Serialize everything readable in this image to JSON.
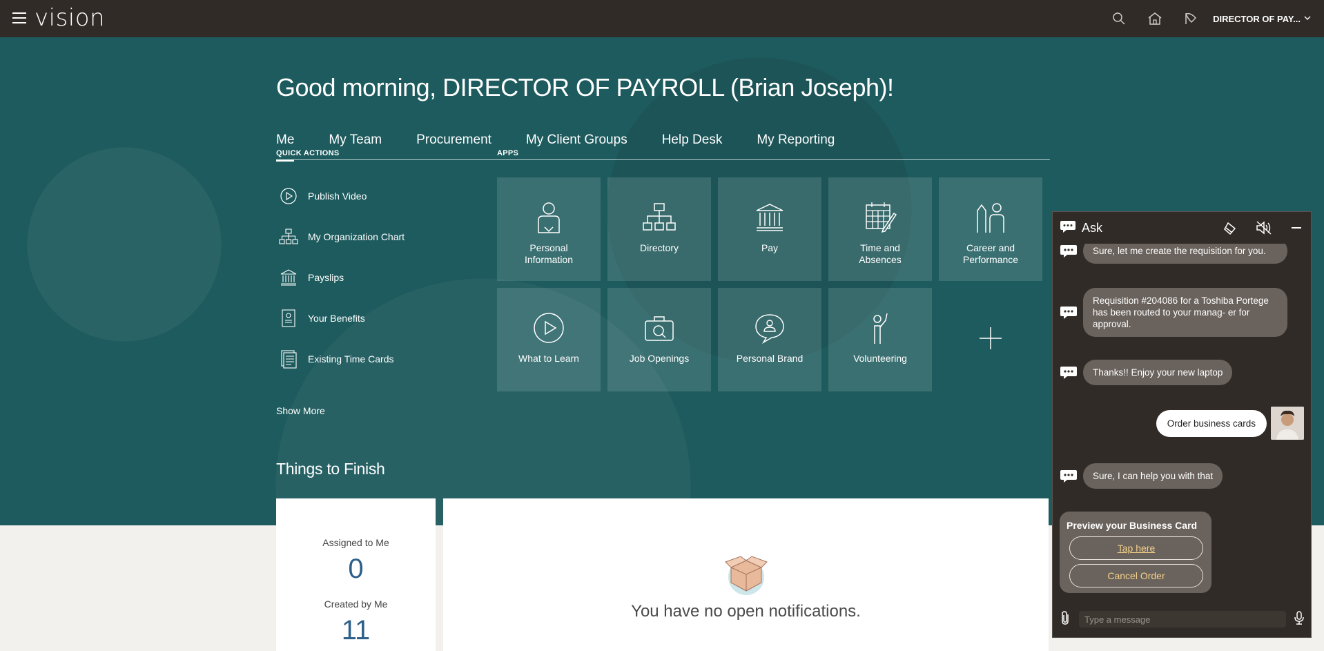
{
  "topbar": {
    "logo": "vision",
    "user_name": "DIRECTOR OF PAY...",
    "icons": [
      "search-icon",
      "home-icon",
      "notifications-icon",
      "chevron-down-icon"
    ]
  },
  "greeting": "Good morning, DIRECTOR OF PAYROLL (Brian Joseph)!",
  "tabs": [
    {
      "label": "Me",
      "active": true
    },
    {
      "label": "My Team"
    },
    {
      "label": "Procurement"
    },
    {
      "label": "My Client Groups"
    },
    {
      "label": "Help Desk"
    },
    {
      "label": "My Reporting"
    }
  ],
  "quick_actions": {
    "title": "QUICK ACTIONS",
    "items": [
      {
        "label": "Publish Video",
        "icon": "play-icon"
      },
      {
        "label": "My Organization Chart",
        "icon": "org-chart-icon"
      },
      {
        "label": "Payslips",
        "icon": "bank-icon"
      },
      {
        "label": "Your Benefits",
        "icon": "benefits-icon"
      },
      {
        "label": "Existing Time Cards",
        "icon": "timecard-icon"
      }
    ],
    "show_more": "Show More"
  },
  "apps": {
    "title": "APPS",
    "tiles": [
      {
        "label": "Personal Information",
        "icon": "person-icon"
      },
      {
        "label": "Directory",
        "icon": "directory-icon"
      },
      {
        "label": "Pay",
        "icon": "bank-icon"
      },
      {
        "label": "Time and Absences",
        "icon": "calendar-icon"
      },
      {
        "label": "Career and Performance",
        "icon": "career-icon"
      },
      {
        "label": "What to Learn",
        "icon": "play-icon"
      },
      {
        "label": "Job Openings",
        "icon": "briefcase-icon"
      },
      {
        "label": "Personal Brand",
        "icon": "personal-brand-icon"
      },
      {
        "label": "Volunteering",
        "icon": "volunteer-icon"
      }
    ],
    "add_icon": "plus-icon"
  },
  "things_to_finish": {
    "title": "Things to Finish",
    "assigned_label": "Assigned to Me",
    "assigned_count": "0",
    "created_label": "Created by Me",
    "created_count": "11",
    "empty_text": "You have no open notifications."
  },
  "chat": {
    "title": "Ask",
    "messages": [
      {
        "from": "bot",
        "text": "Sure, let me create the requisition for you."
      },
      {
        "from": "bot",
        "text": "Requisition #204086 for a Toshiba Portege has been routed to your manag- er for approval."
      },
      {
        "from": "bot",
        "text": "Thanks!! Enjoy your new laptop"
      },
      {
        "from": "user",
        "text": "Order business cards"
      },
      {
        "from": "bot",
        "text": "Sure, I can help you with that"
      }
    ],
    "card": {
      "title": "Preview your Business Card",
      "tap_label": "Tap here",
      "cancel_label": "Cancel Order"
    },
    "input_placeholder": "Type a message"
  }
}
